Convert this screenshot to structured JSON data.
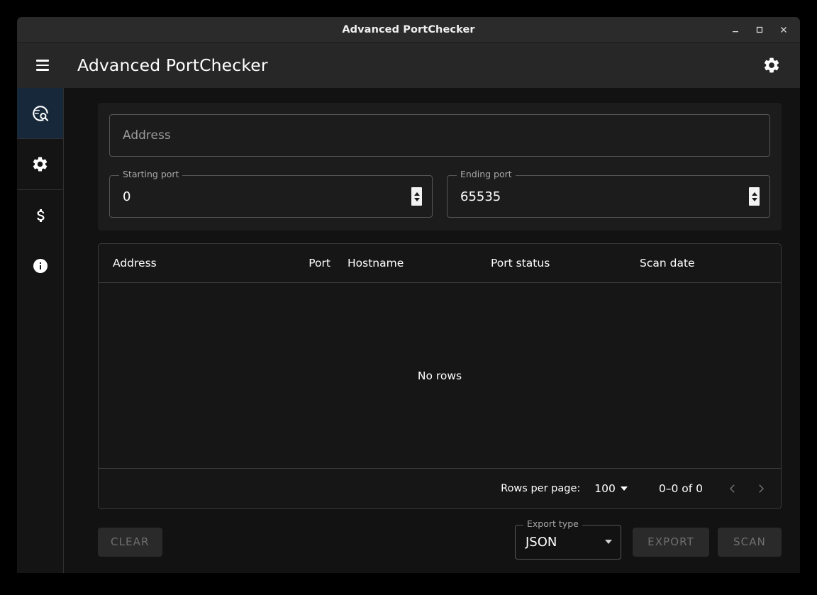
{
  "titlebar": {
    "title": "Advanced PortChecker",
    "minimize_icon": "minimize-icon",
    "maximize_icon": "maximize-icon",
    "close_icon": "close-icon"
  },
  "appbar": {
    "menu_icon": "hamburger-menu-icon",
    "title": "Advanced PortChecker",
    "settings_icon": "gear-icon"
  },
  "sidebar": {
    "items": [
      {
        "name": "port-scan",
        "icon": "globe-search-icon",
        "active": true
      },
      {
        "name": "settings",
        "icon": "gear-icon",
        "active": false
      },
      {
        "name": "donate",
        "icon": "dollar-sign-icon",
        "active": false
      },
      {
        "name": "about",
        "icon": "info-circle-icon",
        "active": false
      }
    ]
  },
  "form": {
    "address": {
      "label": "",
      "placeholder": "Address",
      "value": ""
    },
    "starting_port": {
      "label": "Starting port",
      "value": "0"
    },
    "ending_port": {
      "label": "Ending port",
      "value": "65535"
    }
  },
  "table": {
    "columns": [
      "Address",
      "Port",
      "Hostname",
      "Port status",
      "Scan date"
    ],
    "rows": [],
    "empty_text": "No rows",
    "footer": {
      "rows_per_page_label": "Rows per page:",
      "rows_per_page_value": "100",
      "range_label": "0–0 of 0",
      "prev_icon": "chevron-left-icon",
      "next_icon": "chevron-right-icon"
    }
  },
  "bottom": {
    "clear_label": "CLEAR",
    "export_type_label": "Export type",
    "export_type_value": "JSON",
    "export_label": "EXPORT",
    "scan_label": "SCAN"
  },
  "colors": {
    "window_background": "#121212",
    "titlebar": "#2b2b2b",
    "appbar": "#272727",
    "sidebar": "#141414",
    "active_sidebar": "#16283a",
    "card": "#1c1c1c",
    "table_card": "#161616",
    "border": "#3a3a3a",
    "text_primary": "#ffffff",
    "text_muted": "#9c9c9c",
    "button_disabled_text": "#6f6f6f"
  }
}
